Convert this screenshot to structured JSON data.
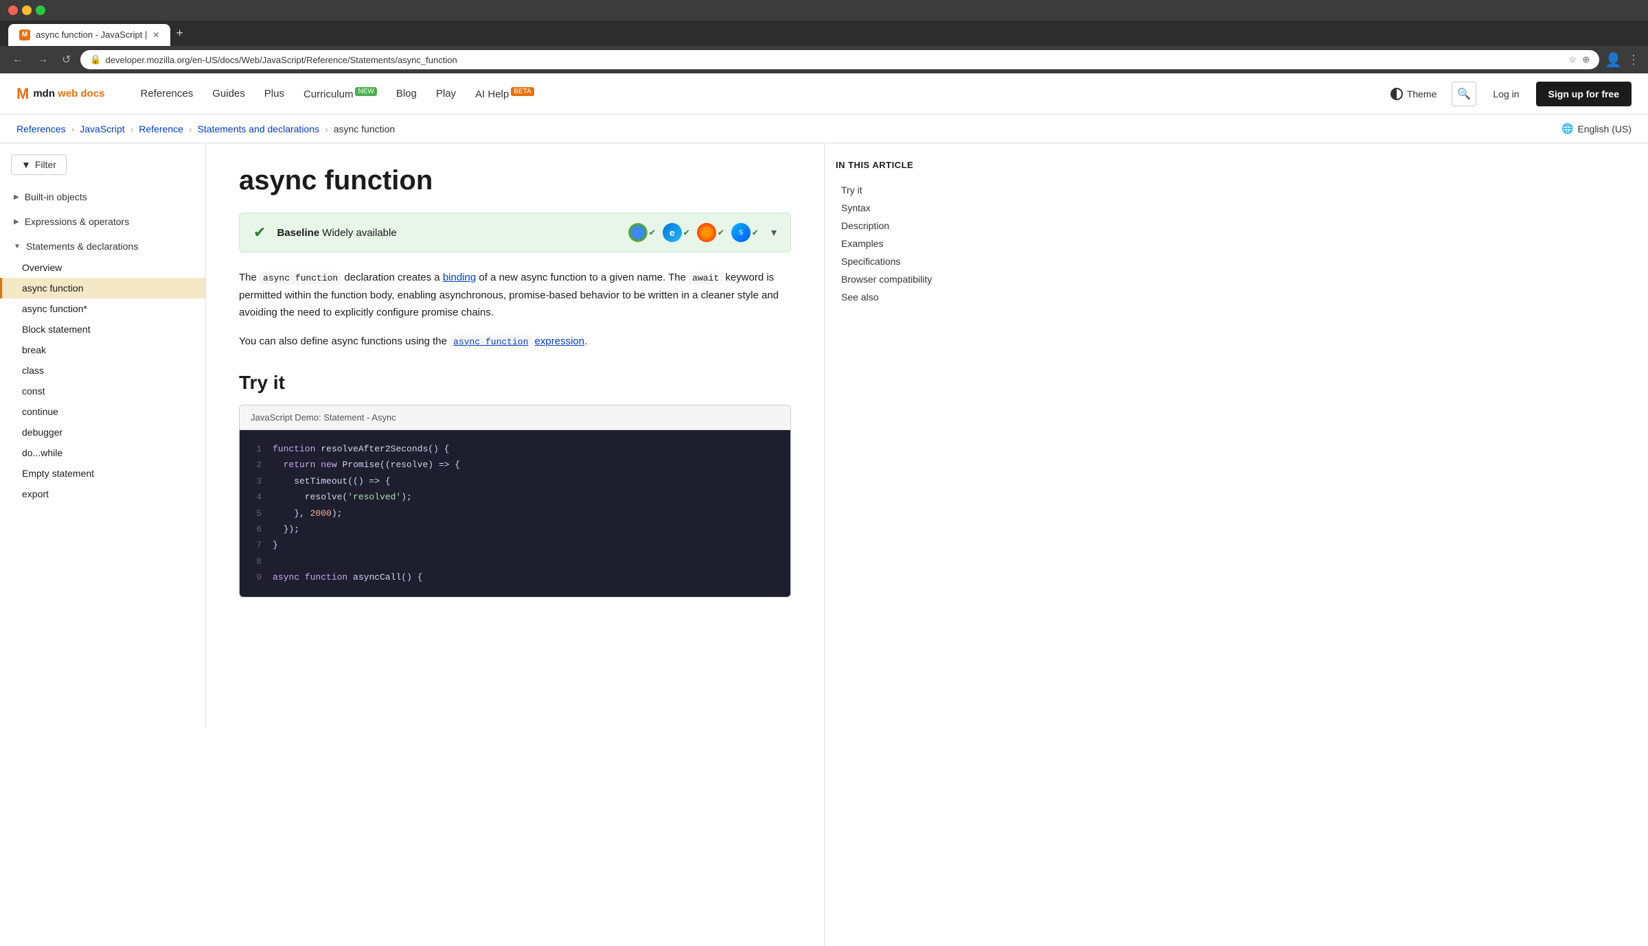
{
  "browser": {
    "tab_title": "async function - JavaScript |",
    "url": "developer.mozilla.org/en-US/docs/Web/JavaScript/Reference/Statements/async_function",
    "nav_back": "←",
    "nav_forward": "→",
    "nav_refresh": "↺"
  },
  "header": {
    "logo_icon": "M",
    "logo_text": "mdn web docs",
    "nav_items": [
      {
        "label": "References",
        "badge": null
      },
      {
        "label": "Guides",
        "badge": null
      },
      {
        "label": "Plus",
        "badge": null
      },
      {
        "label": "Curriculum",
        "badge": "NEW"
      },
      {
        "label": "Blog",
        "badge": null
      },
      {
        "label": "Play",
        "badge": null
      },
      {
        "label": "AI Help",
        "badge": "BETA"
      }
    ],
    "theme_label": "Theme",
    "login_label": "Log in",
    "signup_label": "Sign up for free"
  },
  "breadcrumb": {
    "items": [
      {
        "label": "References",
        "href": "#"
      },
      {
        "label": "JavaScript",
        "href": "#"
      },
      {
        "label": "Reference",
        "href": "#"
      },
      {
        "label": "Statements and declarations",
        "href": "#"
      },
      {
        "label": "async function",
        "href": "#"
      }
    ],
    "lang_label": "English (US)"
  },
  "sidebar": {
    "filter_label": "Filter",
    "sections": [
      {
        "label": "Built-in objects",
        "expanded": false,
        "items": []
      },
      {
        "label": "Expressions & operators",
        "expanded": false,
        "items": []
      },
      {
        "label": "Statements & declarations",
        "expanded": true,
        "items": [
          {
            "label": "Overview",
            "active": false
          },
          {
            "label": "async function",
            "active": true
          },
          {
            "label": "async function*",
            "active": false
          },
          {
            "label": "Block statement",
            "active": false
          },
          {
            "label": "break",
            "active": false
          },
          {
            "label": "class",
            "active": false
          },
          {
            "label": "const",
            "active": false
          },
          {
            "label": "continue",
            "active": false
          },
          {
            "label": "debugger",
            "active": false
          },
          {
            "label": "do...while",
            "active": false
          },
          {
            "label": "Empty statement",
            "active": false
          },
          {
            "label": "export",
            "active": false
          }
        ]
      }
    ]
  },
  "content": {
    "title": "async function",
    "baseline": {
      "icon": "✔",
      "label": "Baseline",
      "description": "Widely available"
    },
    "intro_p1_before": "The ",
    "intro_code": "async function",
    "intro_p1_after": " declaration creates a ",
    "intro_link": "binding",
    "intro_p1_rest": " of a new async function to a given name. The",
    "intro_p2_code": "await",
    "intro_p2_rest": " keyword is permitted within the function body, enabling asynchronous, promise-based behavior to be written in a cleaner style and avoiding the need to explicitly configure promise chains.",
    "intro_p3_before": "You can also define async functions using the ",
    "intro_p3_link": "async function expression",
    "intro_p3_code": "async function",
    "try_it_heading": "Try it",
    "demo_header": "JavaScript Demo: Statement - Async",
    "code_lines": [
      {
        "num": 1,
        "tokens": [
          {
            "t": "kw",
            "v": "function"
          },
          {
            "t": "n",
            "v": " resolveAfter2Seconds() {"
          }
        ]
      },
      {
        "num": 2,
        "tokens": [
          {
            "t": "kw",
            "v": "  return"
          },
          {
            "t": "n",
            "v": " "
          },
          {
            "t": "kw",
            "v": "new"
          },
          {
            "t": "n",
            "v": " Promise((resolve) => {"
          }
        ]
      },
      {
        "num": 3,
        "tokens": [
          {
            "t": "n",
            "v": "    setTimeout(() => {"
          }
        ]
      },
      {
        "num": 4,
        "tokens": [
          {
            "t": "n",
            "v": "      resolve("
          },
          {
            "t": "str",
            "v": "'resolved'"
          },
          {
            "t": "n",
            "v": ");"
          }
        ]
      },
      {
        "num": 5,
        "tokens": [
          {
            "t": "n",
            "v": "    }, "
          },
          {
            "t": "num",
            "v": "2000"
          },
          {
            "t": "n",
            "v": ");"
          }
        ]
      },
      {
        "num": 6,
        "tokens": [
          {
            "t": "n",
            "v": "  });"
          }
        ]
      },
      {
        "num": 7,
        "tokens": [
          {
            "t": "n",
            "v": "}"
          }
        ]
      },
      {
        "num": 8,
        "tokens": [
          {
            "t": "n",
            "v": ""
          }
        ]
      },
      {
        "num": 9,
        "tokens": [
          {
            "t": "kw",
            "v": "async"
          },
          {
            "t": "n",
            "v": " "
          },
          {
            "t": "kw",
            "v": "function"
          },
          {
            "t": "n",
            "v": " asyncCall() {"
          }
        ]
      }
    ]
  },
  "toc": {
    "title": "In this article",
    "items": [
      {
        "label": "Try it",
        "active": false
      },
      {
        "label": "Syntax",
        "active": false
      },
      {
        "label": "Description",
        "active": false
      },
      {
        "label": "Examples",
        "active": false
      },
      {
        "label": "Specifications",
        "active": false
      },
      {
        "label": "Browser compatibility",
        "active": false
      },
      {
        "label": "See also",
        "active": false
      }
    ]
  },
  "browser_icons": [
    {
      "name": "Chrome",
      "color": "#4285F4",
      "symbol": "C"
    },
    {
      "name": "Edge",
      "color": "#0078D7",
      "symbol": "E"
    },
    {
      "name": "Firefox",
      "color": "#FF7139",
      "symbol": "F"
    },
    {
      "name": "Safari",
      "color": "#006CFF",
      "symbol": "S"
    }
  ]
}
